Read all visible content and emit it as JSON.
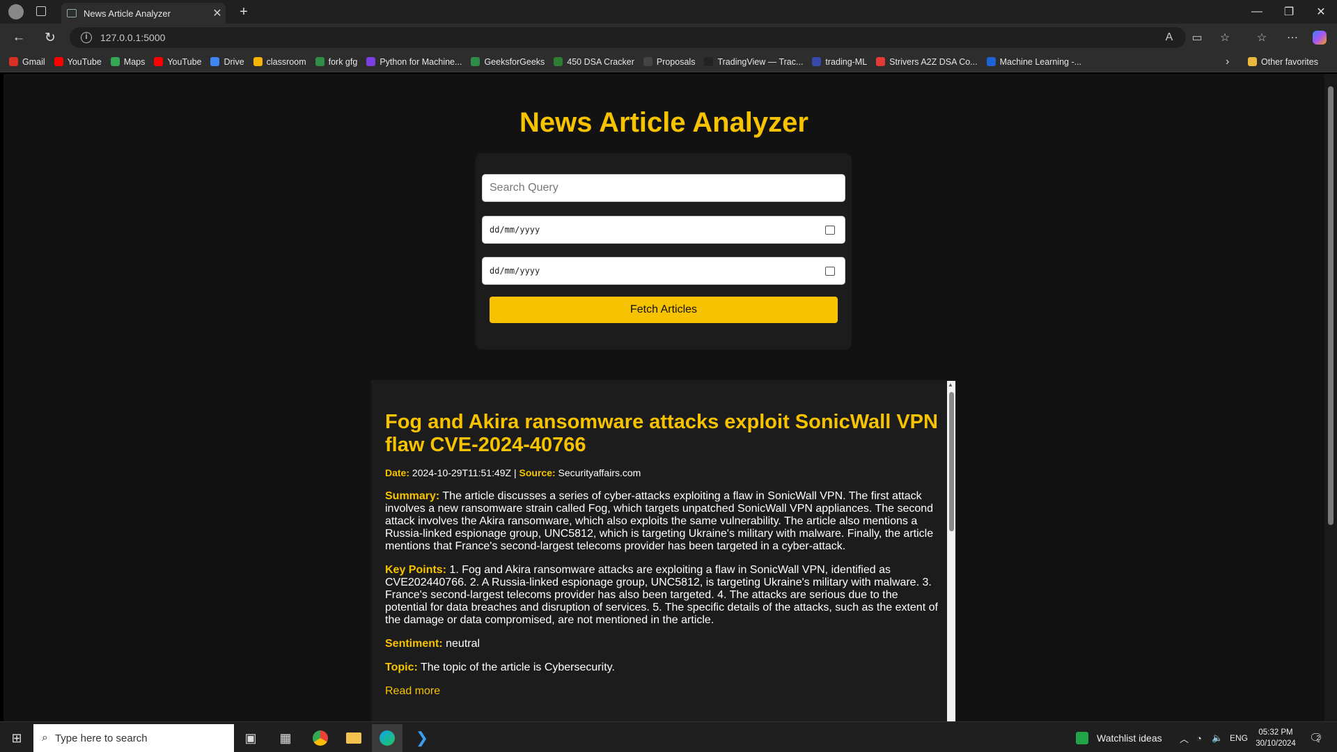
{
  "browser": {
    "tab_title": "News Article Analyzer",
    "url": "127.0.0.1:5000",
    "bookmarks": [
      {
        "label": "Gmail",
        "color": "#d93025"
      },
      {
        "label": "YouTube",
        "color": "#ff0000"
      },
      {
        "label": "Maps",
        "color": "#34a853"
      },
      {
        "label": "YouTube",
        "color": "#ff0000"
      },
      {
        "label": "Drive",
        "color": "#4285f4"
      },
      {
        "label": "classroom",
        "color": "#f4b400"
      },
      {
        "label": "fork gfg",
        "color": "#2f8d46"
      },
      {
        "label": "Python for Machine...",
        "color": "#7b3fe4"
      },
      {
        "label": "GeeksforGeeks",
        "color": "#2f8d46"
      },
      {
        "label": "450 DSA Cracker",
        "color": "#2e7d32"
      },
      {
        "label": "Proposals",
        "color": "#444444"
      },
      {
        "label": "TradingView — Trac...",
        "color": "#222222"
      },
      {
        "label": "trading-ML",
        "color": "#3949ab"
      },
      {
        "label": "Strivers A2Z DSA Co...",
        "color": "#e53935"
      },
      {
        "label": "Machine Learning -...",
        "color": "#1e63d6"
      }
    ],
    "other_favorites": "Other favorites"
  },
  "app": {
    "title": "News Article Analyzer",
    "search_placeholder": "Search Query",
    "date_from_placeholder": "dd/mm/yyyy",
    "date_to_placeholder": "dd/mm/yyyy",
    "fetch_label": "Fetch Articles",
    "accent_color": "#f7c300"
  },
  "article": {
    "title": "Fog and Akira ransomware attacks exploit SonicWall VPN flaw CVE-2024-40766",
    "date_label": "Date:",
    "date": "2024-10-29T11:51:49Z",
    "separator": "|",
    "source_label": "Source:",
    "source": "Securityaffairs.com",
    "summary_label": "Summary:",
    "summary": "The article discusses a series of cyber-attacks exploiting a flaw in SonicWall VPN. The first attack involves a new ransomware strain called Fog, which targets unpatched SonicWall VPN appliances. The second attack involves the Akira ransomware, which also exploits the same vulnerability. The article also mentions a Russia-linked espionage group, UNC5812, which is targeting Ukraine's military with malware. Finally, the article mentions that France's second-largest telecoms provider has been targeted in a cyber-attack.",
    "key_points_label": "Key Points:",
    "key_points": "1. Fog and Akira ransomware attacks are exploiting a flaw in SonicWall VPN, identified as CVE202440766. 2. A Russia-linked espionage group, UNC5812, is targeting Ukraine's military with malware. 3. France's second-largest telecoms provider has also been targeted. 4. The attacks are serious due to the potential for data breaches and disruption of services. 5. The specific details of the attacks, such as the extent of the damage or data compromised, are not mentioned in the article.",
    "sentiment_label": "Sentiment:",
    "sentiment": "neutral",
    "topic_label": "Topic:",
    "topic": "The topic of the article is Cybersecurity.",
    "read_more": "Read more"
  },
  "taskbar": {
    "search_placeholder": "Type here to search",
    "watchlist": "Watchlist ideas",
    "language": "ENG",
    "time": "05:32 PM",
    "date": "30/10/2024",
    "notification_count": "2"
  }
}
